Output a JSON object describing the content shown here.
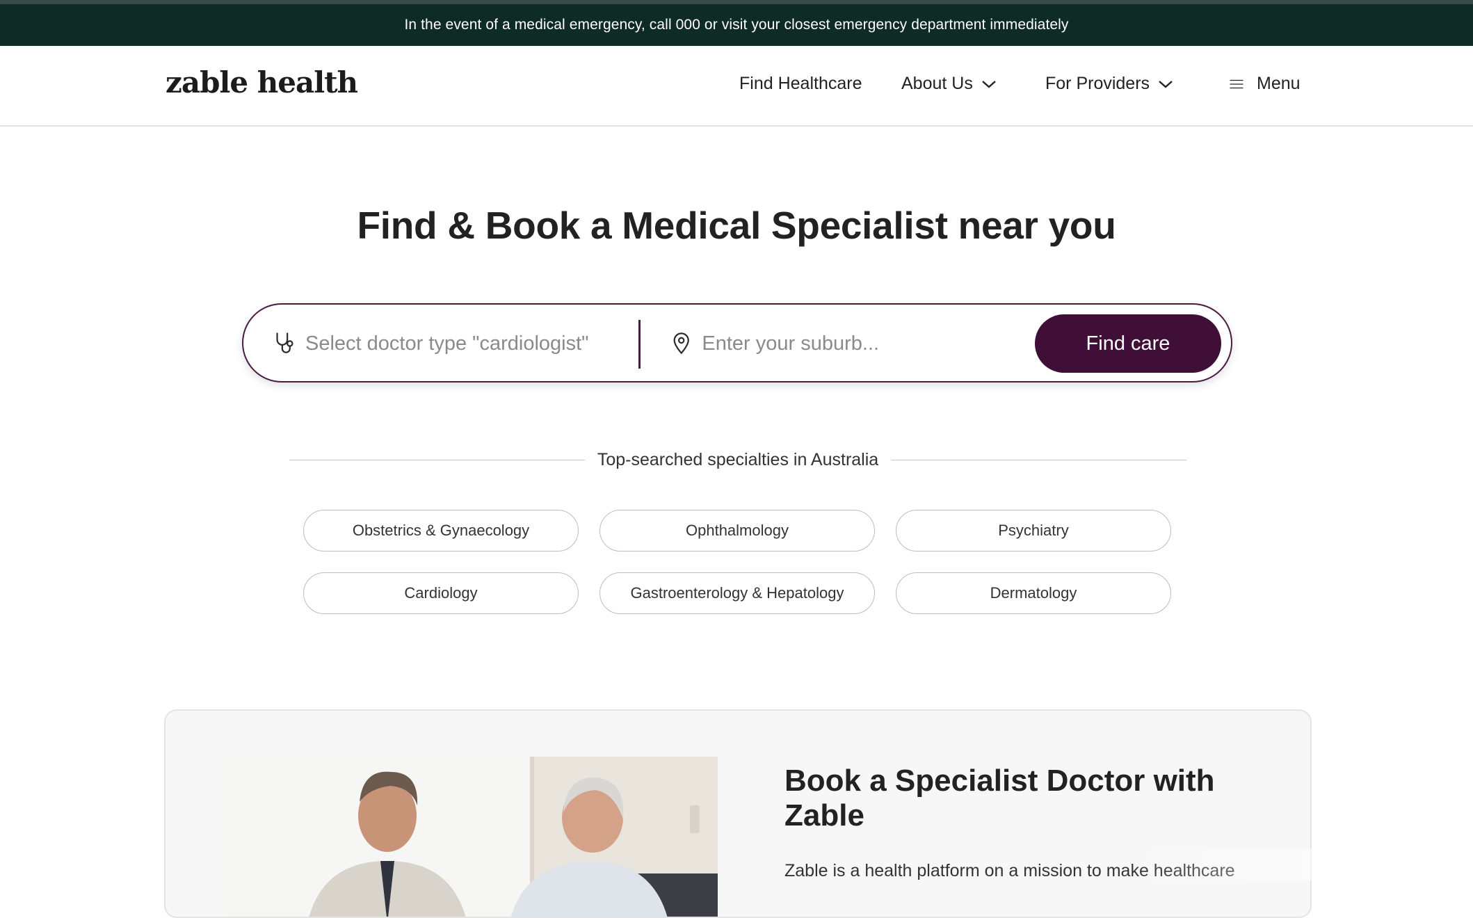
{
  "emergency_banner": "In the event of a medical emergency, call 000 or visit your closest emergency department immediately",
  "header": {
    "logo": "zable health",
    "nav": [
      {
        "label": "Find Healthcare",
        "has_dropdown": false
      },
      {
        "label": "About Us",
        "has_dropdown": true
      },
      {
        "label": "For Providers",
        "has_dropdown": true
      }
    ],
    "menu_label": "Menu",
    "menu_icon": "hamburger-icon"
  },
  "hero": {
    "title": "Find & Book a Medical Specialist near you"
  },
  "search": {
    "doctor_placeholder": "Select doctor type \"cardiologist\"",
    "doctor_icon": "stethoscope-icon",
    "suburb_placeholder": "Enter your suburb...",
    "suburb_icon": "location-pin-icon",
    "button_label": "Find care"
  },
  "specialties": {
    "heading": "Top-searched specialties in Australia",
    "items": [
      "Obstetrics & Gynaecology",
      "Ophthalmology",
      "Psychiatry",
      "Cardiology",
      "Gastroenterology & Hepatology",
      "Dermatology"
    ]
  },
  "feature": {
    "title": "Book a Specialist Doctor with Zable",
    "body": "Zable is a health platform on a mission to make healthcare"
  },
  "colors": {
    "banner_bg": "#0e2b26",
    "brand_plum": "#3f0f37",
    "search_border": "#4a1a3f"
  }
}
